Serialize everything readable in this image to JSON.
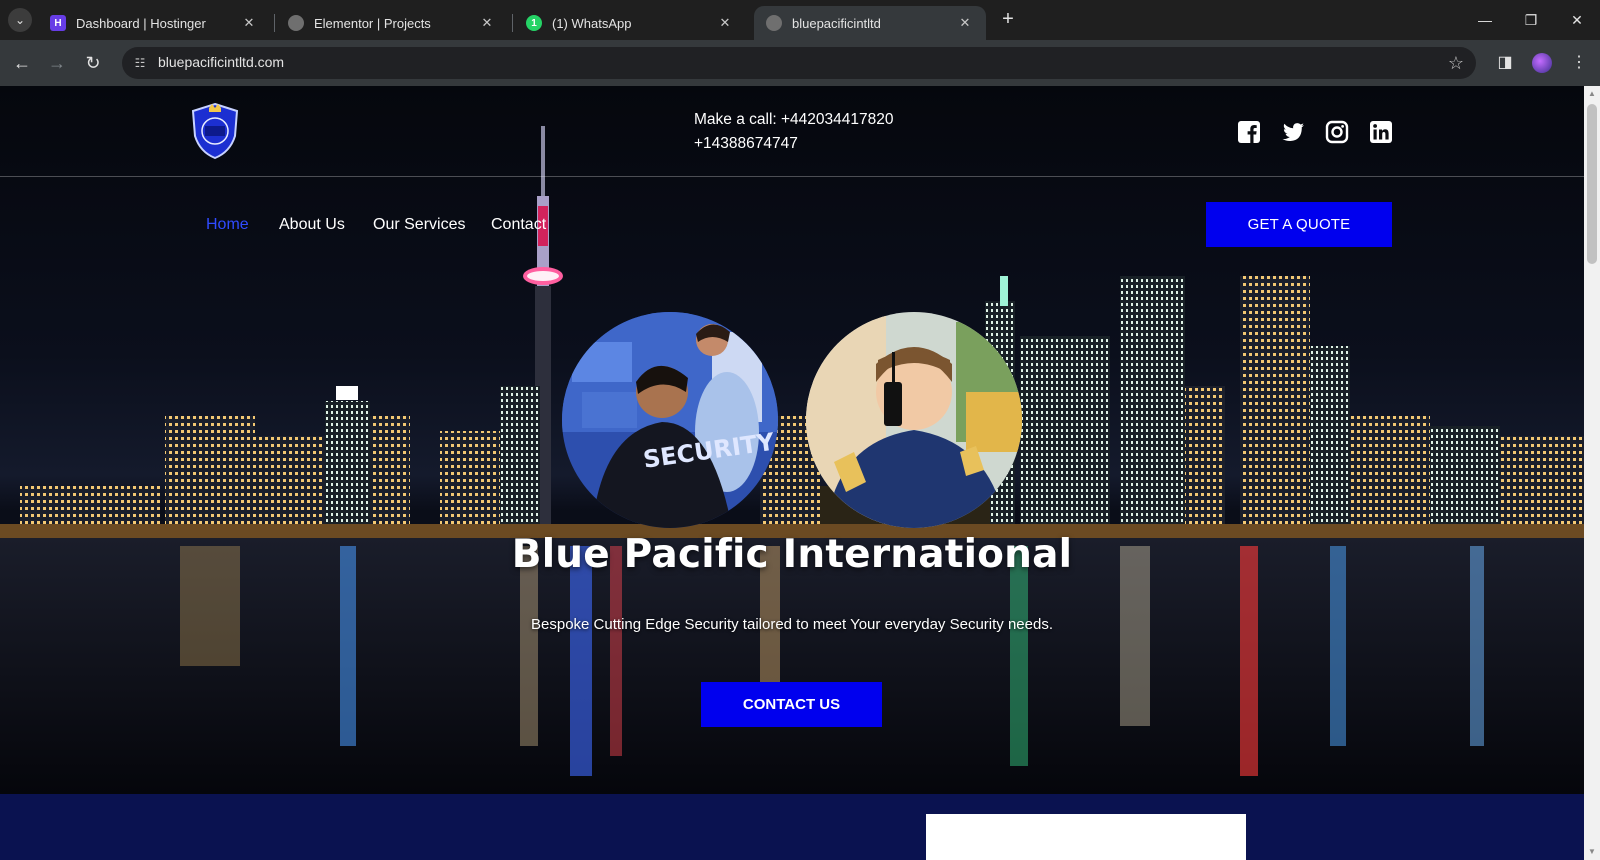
{
  "browser": {
    "tabs": [
      {
        "title": "Dashboard | Hostinger",
        "favicon": "hostinger-icon",
        "color": "#673de6"
      },
      {
        "title": "Elementor | Projects",
        "favicon": "globe-icon",
        "color": "#6f6f6f"
      },
      {
        "title": "(1) WhatsApp",
        "favicon": "whatsapp-icon",
        "color": "#25d366"
      },
      {
        "title": "bluepacificintltd",
        "favicon": "globe-icon",
        "color": "#6f6f6f",
        "active": true
      }
    ],
    "tab_close_glyph": "✕",
    "new_tab_glyph": "+",
    "url": "bluepacificintltd.com",
    "window_controls": [
      "—",
      "❐",
      "✕"
    ]
  },
  "header": {
    "call_line1": "Make a call: +442034417820",
    "call_line2": "+14388674747",
    "social": [
      "facebook-icon",
      "twitter-icon",
      "instagram-icon",
      "linkedin-icon"
    ]
  },
  "nav": {
    "items": [
      {
        "label": "Home",
        "active": true
      },
      {
        "label": "About Us"
      },
      {
        "label": "Our Services"
      },
      {
        "label": "Contact"
      }
    ],
    "quote_button": "GET A QUOTE"
  },
  "hero": {
    "title": "Blue Pacific International",
    "subtitle": "Bespoke Cutting Edge Security tailored to meet Your everyday Security needs.",
    "contact_button": "CONTACT US",
    "badge_text": "SECURITY"
  },
  "colors": {
    "accent": "#0000ee",
    "nav_active": "#2f4bff",
    "lower_section": "#0a1250"
  }
}
